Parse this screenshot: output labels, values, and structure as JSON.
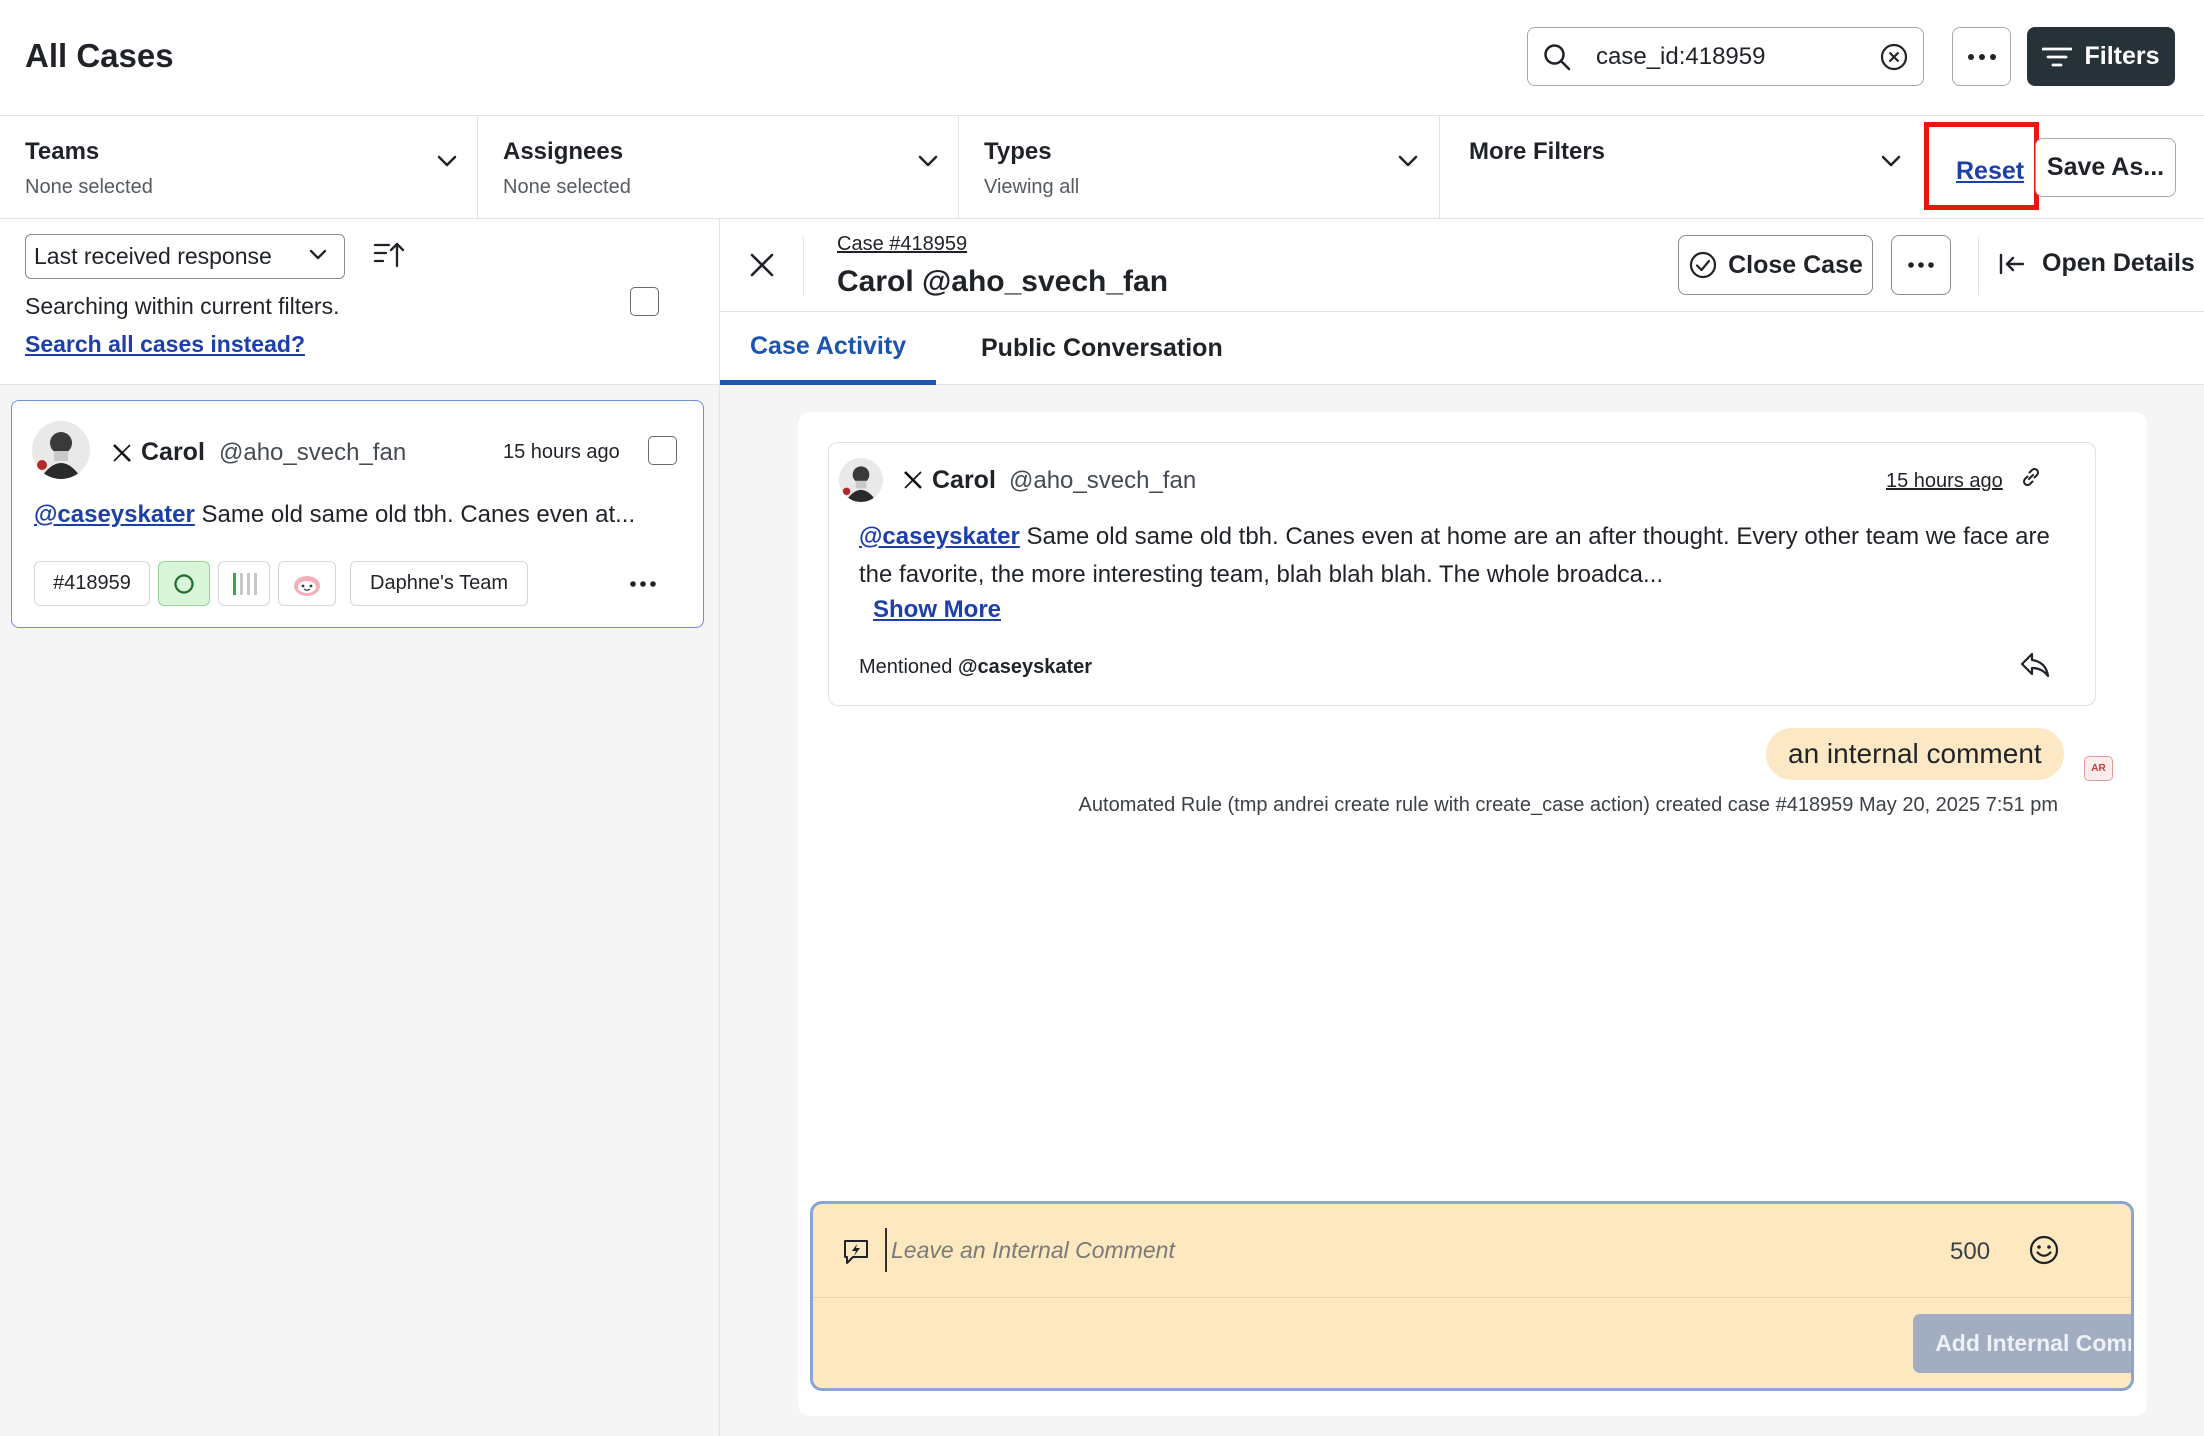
{
  "header": {
    "title": "All Cases",
    "search_value": "case_id:418959",
    "filters_label": "Filters"
  },
  "filterbar": {
    "teams": {
      "label": "Teams",
      "sub": "None selected"
    },
    "assignees": {
      "label": "Assignees",
      "sub": "None selected"
    },
    "types": {
      "label": "Types",
      "sub": "Viewing all"
    },
    "more_filters": {
      "label": "More Filters"
    },
    "reset_label": "Reset",
    "save_as_label": "Save As..."
  },
  "left": {
    "sort_value": "Last received response",
    "search_note": "Searching within current filters.",
    "search_all_link": "Search all cases instead?",
    "card": {
      "name": "Carol",
      "handle": "@aho_svech_fan",
      "time": "15 hours ago",
      "mention": "@caseyskater",
      "text": " Same old same old tbh. Canes even at...",
      "case_tag": "#418959",
      "team_tag": "Daphne's Team"
    }
  },
  "case": {
    "number": "Case #418959",
    "title": "Carol @aho_svech_fan",
    "close_label": "Close Case",
    "open_details_label": "Open Details",
    "tabs": [
      "Case Activity",
      "Public Conversation"
    ],
    "message": {
      "name": "Carol",
      "handle": "@aho_svech_fan",
      "time": "15 hours ago",
      "mention": "@caseyskater",
      "text": " Same old same old tbh. Canes even at home are an after thought. Every other team we face are the favorite, the more interesting team, blah blah blah. The whole broadca...",
      "show_more": "Show More",
      "mentioned_prefix": "Mentioned ",
      "mentioned_user": "@caseyskater"
    },
    "comment": {
      "text": "an internal comment",
      "badge": "AR",
      "meta": "Automated Rule (tmp andrei create rule with create_case action) created case #418959 May 20, 2025 7:51 pm"
    },
    "composer": {
      "placeholder": "Leave an Internal Comment",
      "char_count": "500",
      "submit_label": "Add Internal Comment"
    }
  },
  "colors": {
    "accent": "#1c55b0",
    "link": "#1c3faa",
    "dark_button": "#263238",
    "highlight_red": "#e8160c",
    "comment_bg": "#fde8bf"
  }
}
